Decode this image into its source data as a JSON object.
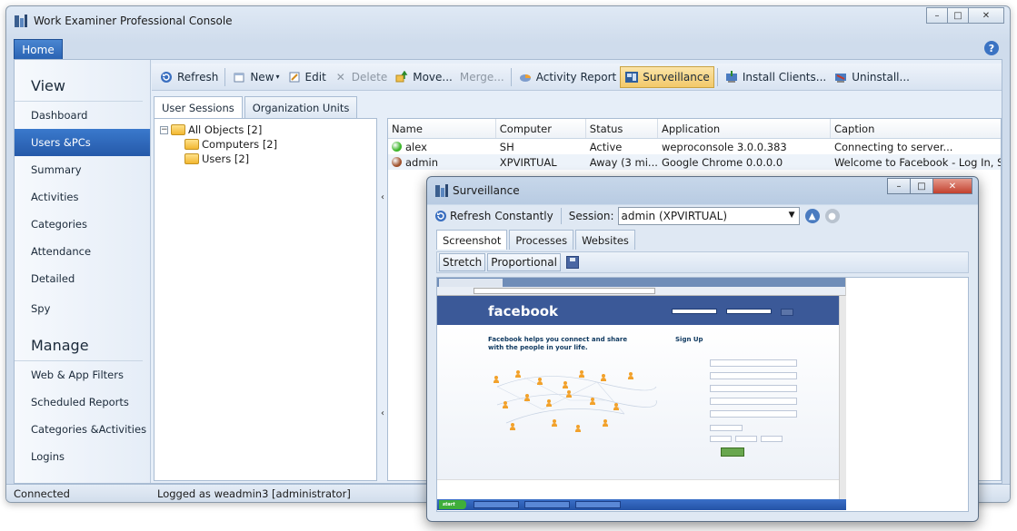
{
  "window": {
    "title": "Work Examiner Professional Console",
    "minimize": "–",
    "maximize": "□",
    "close": "✕"
  },
  "ribbon": {
    "home_tab": "Home",
    "help": "?"
  },
  "sidebar": {
    "view_header": "View",
    "view_items": [
      "Dashboard",
      "Users &PCs",
      "Summary",
      "Activities",
      "Categories",
      "Attendance",
      "Detailed",
      "Spy"
    ],
    "active_item": "Users &PCs",
    "manage_header": "Manage",
    "manage_items": [
      "Web & App Filters",
      "Scheduled Reports",
      "Categories &Activities",
      "Logins"
    ]
  },
  "toolbar": {
    "refresh": "Refresh",
    "new": "New",
    "edit": "Edit",
    "delete": "Delete",
    "move": "Move...",
    "merge": "Merge...",
    "activity_report": "Activity Report",
    "surveillance": "Surveillance",
    "install_clients": "Install Clients...",
    "uninstall": "Uninstall..."
  },
  "tabs": {
    "user_sessions": "User Sessions",
    "organization_units": "Organization Units"
  },
  "tree": {
    "root": "All Objects [2]",
    "computers": "Computers [2]",
    "users": "Users [2]",
    "expander": "−"
  },
  "grid": {
    "columns": [
      "Name",
      "Computer",
      "Status",
      "Application",
      "Caption"
    ],
    "rows": [
      {
        "name": "alex",
        "computer": "SH",
        "status": "Active",
        "application": "weproconsole 3.0.0.383",
        "caption": "Connecting to server...",
        "status_color": "#3cb52a"
      },
      {
        "name": "admin",
        "computer": "XPVIRTUAL",
        "status": "Away (3 mi...",
        "application": "Google Chrome 0.0.0.0",
        "caption": "Welcome to Facebook - Log In, Sig...",
        "status_color": "#a0522d"
      }
    ]
  },
  "statusbar": {
    "connection": "Connected",
    "logged_as": "Logged as weadmin3 [administrator]"
  },
  "surveillance": {
    "title": "Surveillance",
    "refresh": "Refresh",
    "constantly": "Constantly",
    "session_label": "Session:",
    "session_value": "admin (XPVIRTUAL)",
    "tabs": [
      "Screenshot",
      "Processes",
      "Websites"
    ],
    "stretch": "Stretch",
    "proportional": "Proportional",
    "screenshot": {
      "logo": "facebook",
      "tagline": "Facebook helps you connect and share with the people in your life.",
      "signup": "Sign Up",
      "start": "start"
    }
  }
}
